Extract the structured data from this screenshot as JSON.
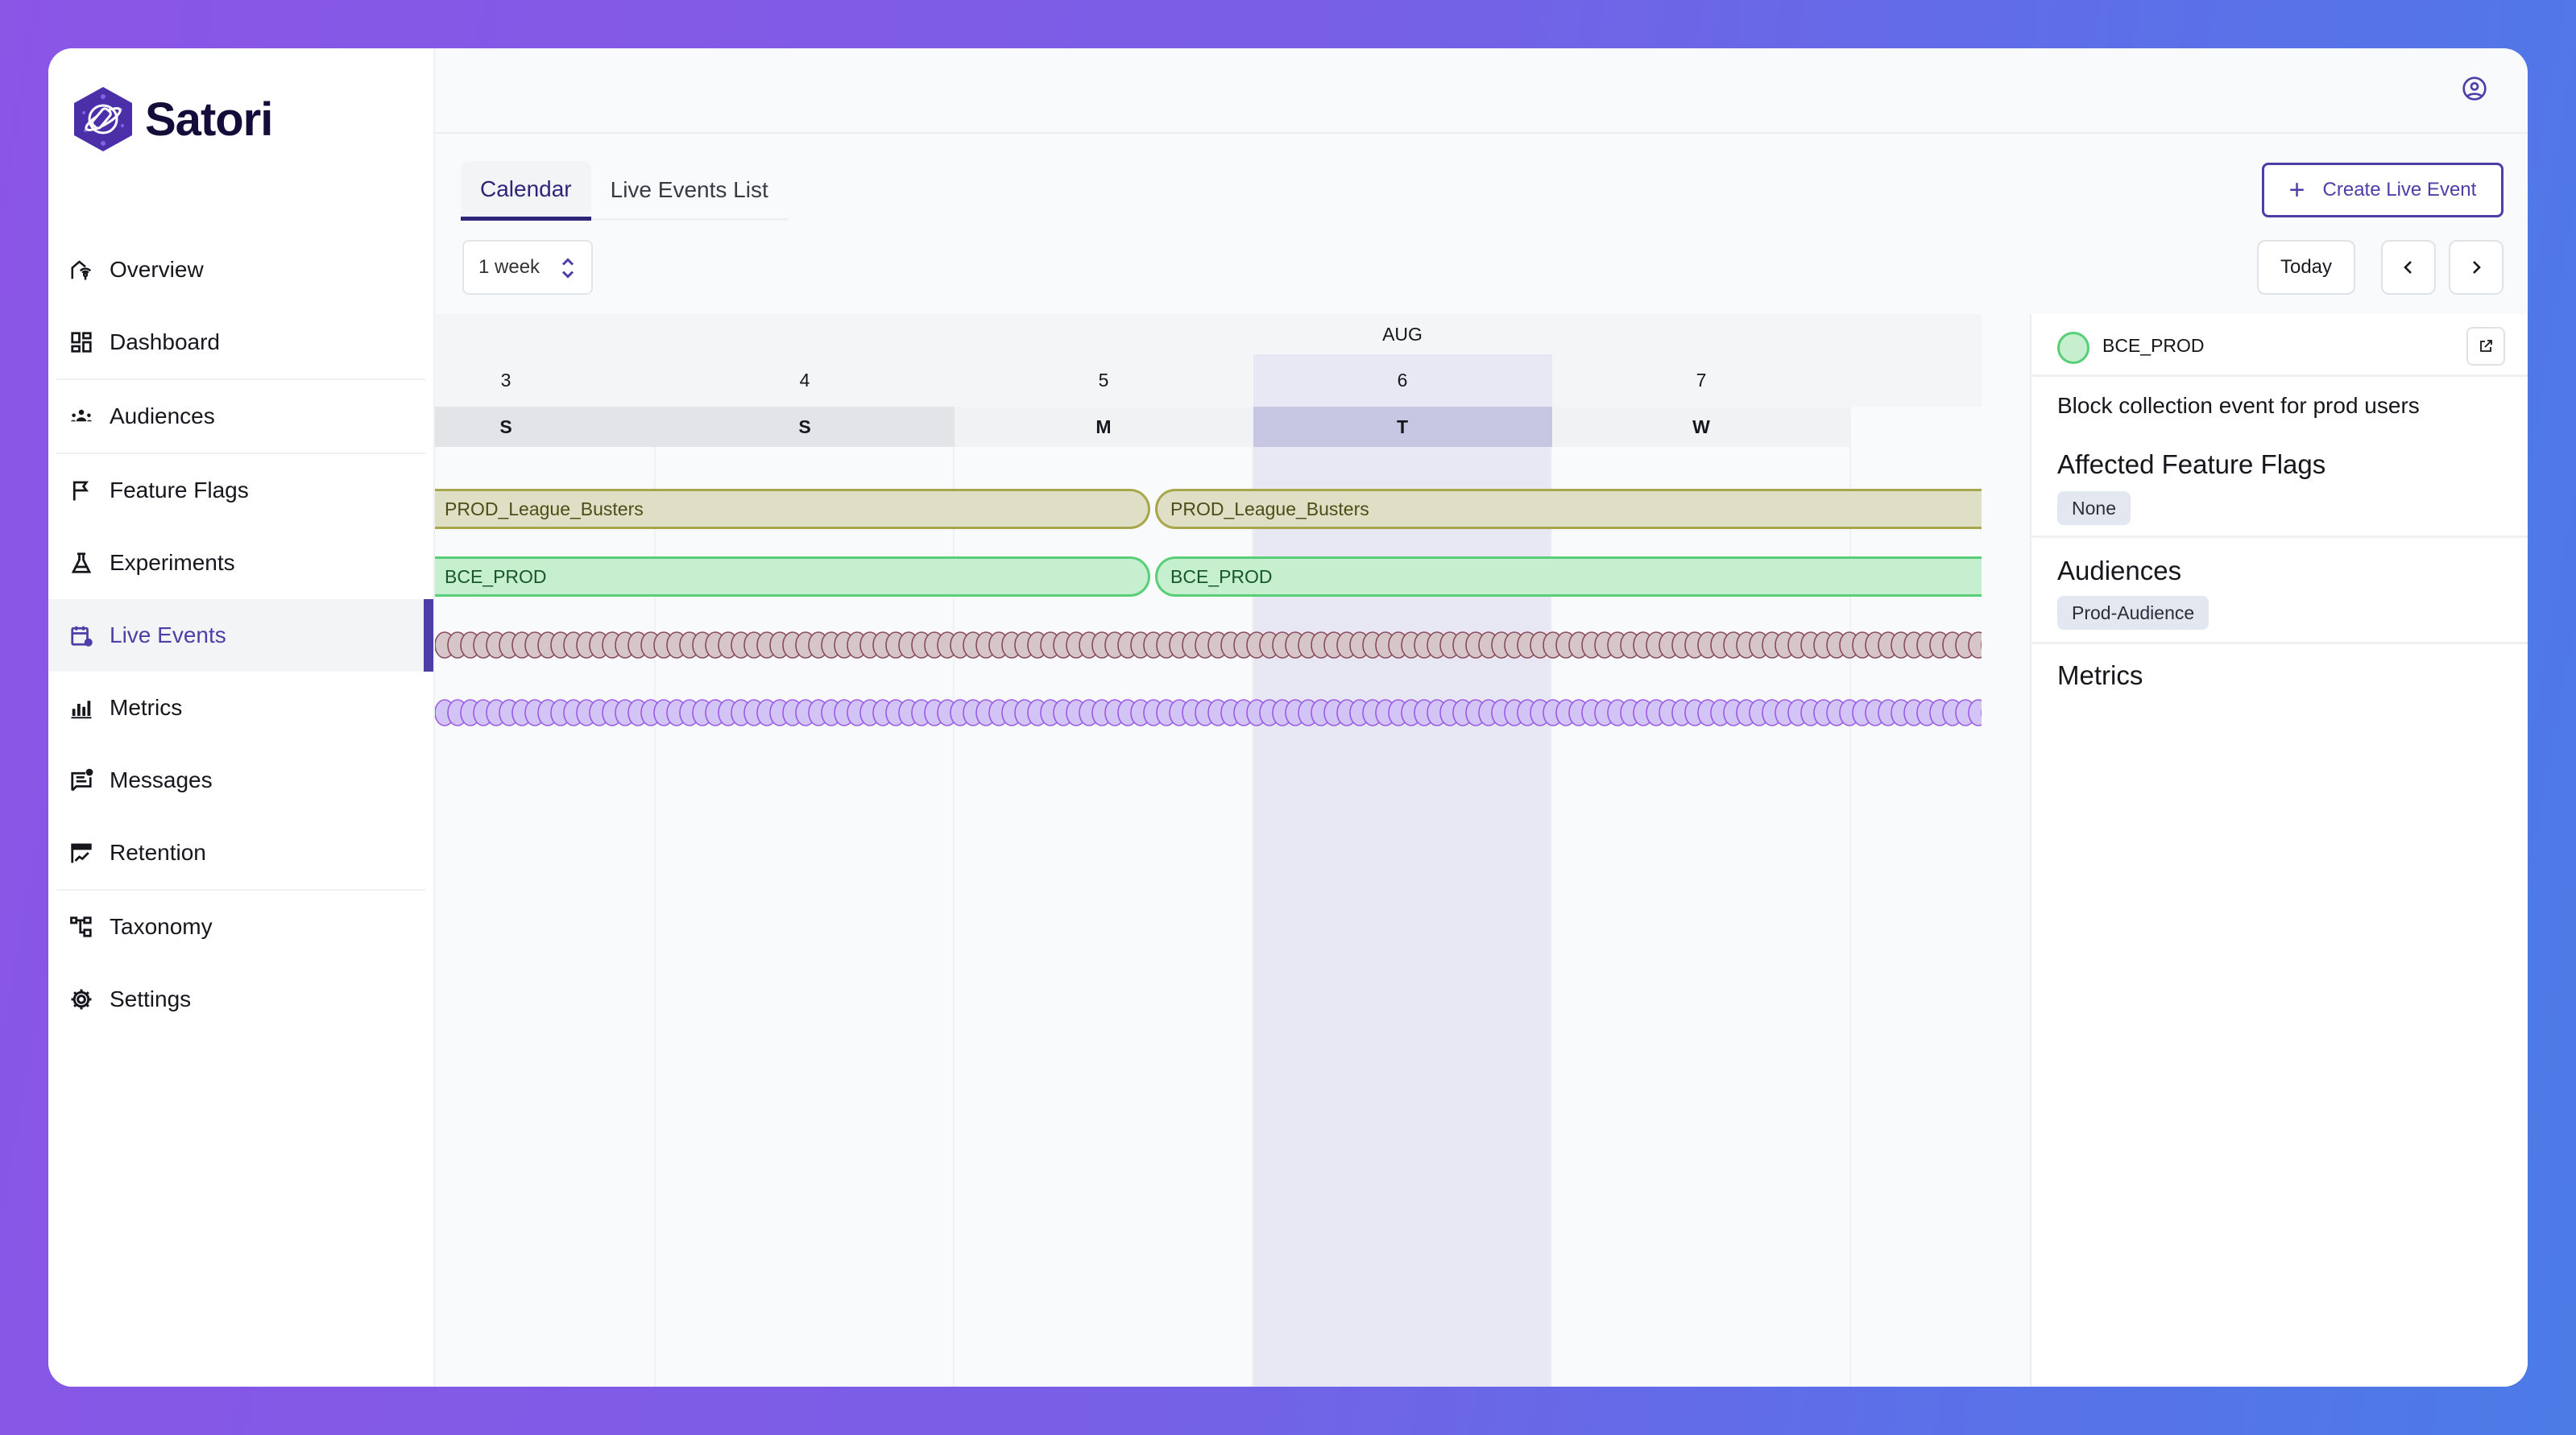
{
  "app": {
    "name": "Satori"
  },
  "sidebar": {
    "items": [
      {
        "label": "Overview",
        "icon": "overview-icon"
      },
      {
        "label": "Dashboard",
        "icon": "dashboard-icon"
      },
      {
        "label": "Audiences",
        "icon": "audiences-icon"
      },
      {
        "label": "Feature Flags",
        "icon": "flag-icon"
      },
      {
        "label": "Experiments",
        "icon": "flask-icon"
      },
      {
        "label": "Live Events",
        "icon": "calendar-clock-icon",
        "active": true
      },
      {
        "label": "Metrics",
        "icon": "bar-chart-icon"
      },
      {
        "label": "Messages",
        "icon": "message-icon"
      },
      {
        "label": "Retention",
        "icon": "retention-icon"
      },
      {
        "label": "Taxonomy",
        "icon": "taxonomy-icon"
      },
      {
        "label": "Settings",
        "icon": "gear-icon"
      }
    ]
  },
  "header": {
    "user_icon": "user-circle-icon"
  },
  "tabs": [
    {
      "label": "Calendar",
      "active": true
    },
    {
      "label": "Live Events List",
      "active": false
    }
  ],
  "toolbar": {
    "range_select": "1 week",
    "create_label": "Create Live Event",
    "today_label": "Today",
    "prev_icon": "chevron-left-icon",
    "next_icon": "chevron-right-icon"
  },
  "calendar": {
    "month": "AUG",
    "days": [
      {
        "date": "3",
        "dow": "S",
        "weekend": true
      },
      {
        "date": "4",
        "dow": "S",
        "weekend": true
      },
      {
        "date": "5",
        "dow": "M"
      },
      {
        "date": "6",
        "dow": "T",
        "today": true
      },
      {
        "date": "7",
        "dow": "W"
      }
    ],
    "events": [
      {
        "name": "PROD_League_Busters",
        "type": "league",
        "segment": "first"
      },
      {
        "name": "PROD_League_Busters",
        "type": "league",
        "segment": "second"
      },
      {
        "name": "BCE_PROD",
        "type": "bce",
        "segment": "first",
        "selected": true
      },
      {
        "name": "BCE_PROD",
        "type": "bce",
        "segment": "second"
      }
    ],
    "recurring_rows": [
      {
        "fill": "#d6c6ca",
        "stroke": "#8a4a5a"
      },
      {
        "fill": "#d2c5f5",
        "stroke": "#9b5ae6"
      }
    ]
  },
  "panel": {
    "title": "BCE_PROD",
    "status_color": "#c6efcf",
    "description": "Block collection event for prod users",
    "feature_flags_title": "Affected Feature Flags",
    "feature_flags": [
      "None"
    ],
    "audiences_title": "Audiences",
    "audiences": [
      "Prod-Audience"
    ],
    "metrics_title": "Metrics"
  }
}
